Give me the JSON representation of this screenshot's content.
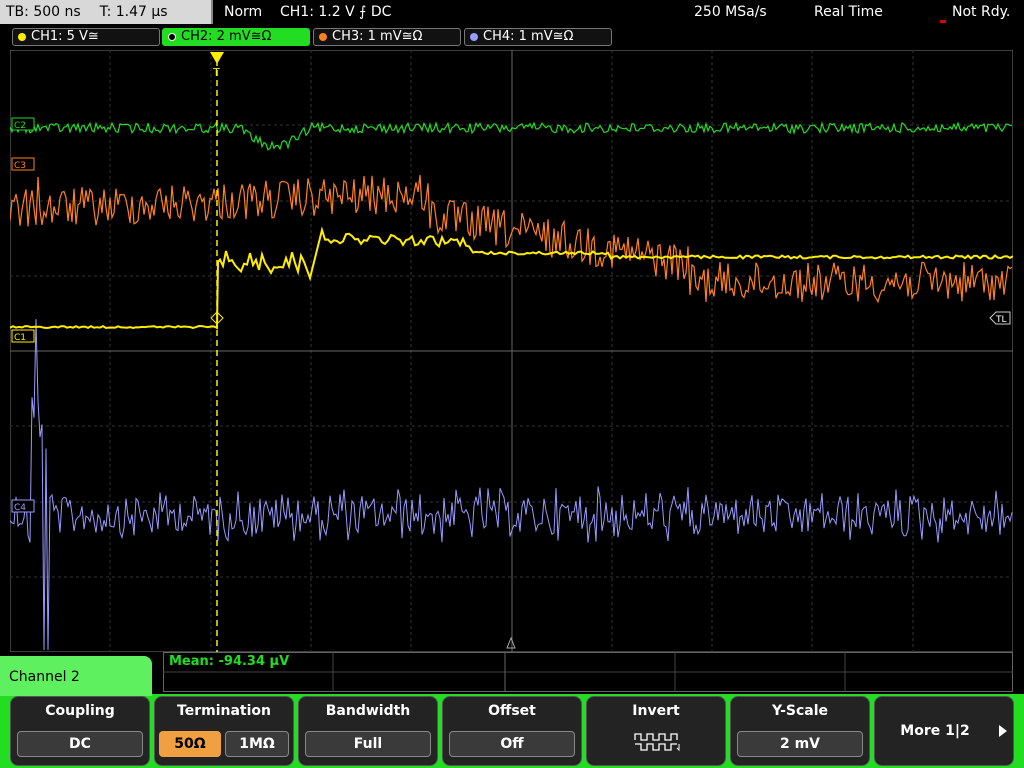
{
  "status_bar": {
    "timebase": "TB: 500 ns",
    "trigger_time": "T: 1.47 µs",
    "trigger_mode": "Norm",
    "trigger_info": "CH1: 1.2 V ⨍ DC",
    "sample_rate": "250 MSa/s",
    "acq_mode": "Real Time",
    "status": "Not Rdy."
  },
  "channel_tabs": [
    {
      "label": "CH1: 5 V≅",
      "color": "#ffee00"
    },
    {
      "label": "CH2: 2 mV≅Ω",
      "color": "#22dd22"
    },
    {
      "label": "CH3: 1 mV≅Ω",
      "color": "#ff8020"
    },
    {
      "label": "CH4: 1 mV≅Ω",
      "color": "#9999ff"
    }
  ],
  "markers": {
    "c2": "C2",
    "c3": "C3",
    "c1": "C1",
    "c4": "C4",
    "trigger_level": "TL",
    "trigger": "T"
  },
  "measurement": {
    "label": "Mean: -94.34 µV"
  },
  "panel": {
    "title": "Channel 2",
    "coupling": {
      "label": "Coupling",
      "value": "DC"
    },
    "termination": {
      "label": "Termination",
      "opt1": "50Ω",
      "opt2": "1MΩ"
    },
    "bandwidth": {
      "label": "Bandwidth",
      "value": "Full"
    },
    "offset": {
      "label": "Offset",
      "value": "Off"
    },
    "invert": {
      "label": "Invert"
    },
    "yscale": {
      "label": "Y-Scale",
      "value": "2 mV"
    },
    "more": {
      "label": "More 1|2"
    }
  },
  "colors": {
    "ch1": "#ffee00",
    "ch2": "#22dd22",
    "ch3": "#ff8020",
    "ch4": "#9999ff",
    "panel_accent": "#22dd22"
  }
}
